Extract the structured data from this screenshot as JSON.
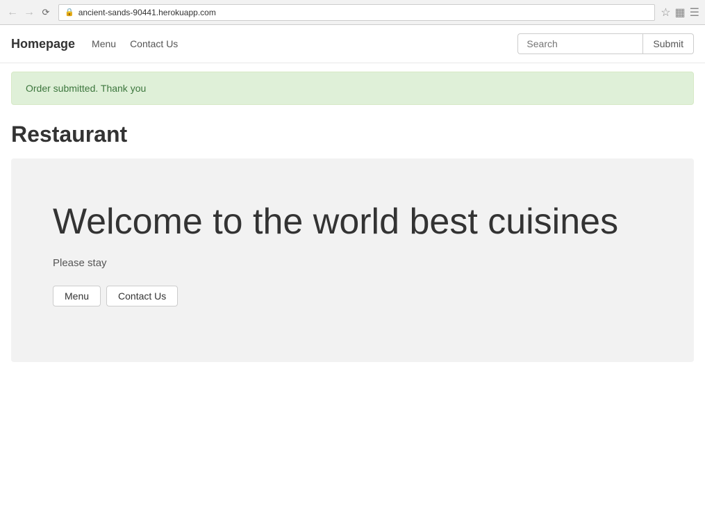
{
  "browser": {
    "url": "ancient-sands-90441.herokuapp.com",
    "back_disabled": true,
    "forward_disabled": true
  },
  "navbar": {
    "brand": "Homepage",
    "links": [
      {
        "label": "Menu",
        "href": "#"
      },
      {
        "label": "Contact Us",
        "href": "#"
      }
    ],
    "search": {
      "placeholder": "Search",
      "value": "",
      "submit_label": "Submit"
    }
  },
  "alert": {
    "message": "Order submitted. Thank you"
  },
  "page": {
    "title": "Restaurant"
  },
  "hero": {
    "heading": "Welcome to the world best cuisines",
    "subtext": "Please stay",
    "buttons": [
      {
        "label": "Menu"
      },
      {
        "label": "Contact Us"
      }
    ]
  }
}
